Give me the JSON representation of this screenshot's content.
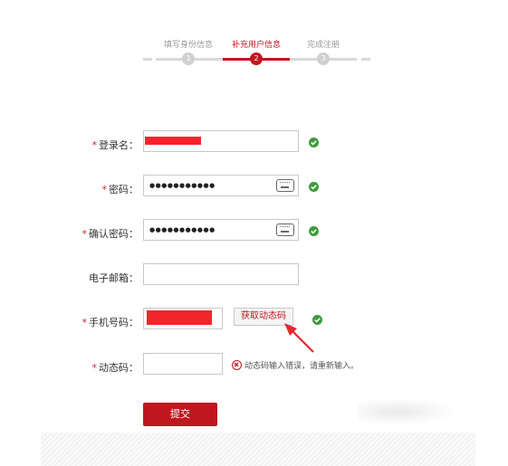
{
  "steps": [
    {
      "label": "填写身份信息",
      "number": "1",
      "active": false
    },
    {
      "label": "补充用户信息",
      "number": "2",
      "active": true
    },
    {
      "label": "完成注册",
      "number": "3",
      "active": false
    }
  ],
  "form": {
    "username": {
      "label": "登录名：",
      "required": true
    },
    "password": {
      "label": "密码：",
      "required": true,
      "value": "●●●●●●●●●●●"
    },
    "confirm_password": {
      "label": "确认密码：",
      "required": true,
      "value": "●●●●●●●●●●●"
    },
    "email": {
      "label": "电子邮箱：",
      "required": false,
      "value": ""
    },
    "phone": {
      "label": "手机号码：",
      "required": true
    },
    "get_code_button": "获取动态码",
    "dynamic_code": {
      "label": "动态码：",
      "required": true,
      "value": ""
    },
    "dynamic_code_error": "动态码输入错误，请重新输入。",
    "required_mark": "*",
    "submit_label": "提交"
  },
  "colors": {
    "accent": "#c0171f",
    "success": "#3d9b3d",
    "redaction": "#f2252b"
  }
}
